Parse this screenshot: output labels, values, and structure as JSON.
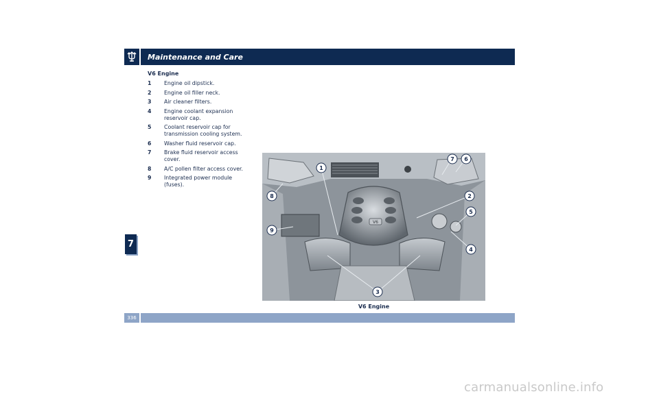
{
  "header": {
    "title": "Maintenance and Care",
    "logo_icon": "trident-icon"
  },
  "chapter_tab": "7",
  "footer": {
    "page_number": "336"
  },
  "section": {
    "title": "V6 Engine"
  },
  "legend": [
    {
      "num": "1",
      "text": "Engine oil dipstick."
    },
    {
      "num": "2",
      "text": "Engine oil filler neck."
    },
    {
      "num": "3",
      "text": "Air cleaner filters."
    },
    {
      "num": "4",
      "text": "Engine coolant expansion reservoir cap."
    },
    {
      "num": "5",
      "text": "Coolant reservoir cap for transmission cooling system."
    },
    {
      "num": "6",
      "text": "Washer fluid reservoir cap."
    },
    {
      "num": "7",
      "text": "Brake fluid reservoir access cover."
    },
    {
      "num": "8",
      "text": "A/C pollen filter access cover."
    },
    {
      "num": "9",
      "text": "Integrated power module (fuses)."
    }
  ],
  "figure": {
    "caption": "V6 Engine",
    "engine_badge": "V6",
    "callouts": [
      "1",
      "2",
      "3",
      "4",
      "5",
      "6",
      "7",
      "8",
      "9"
    ]
  },
  "watermark": "carmanualsonline.info"
}
